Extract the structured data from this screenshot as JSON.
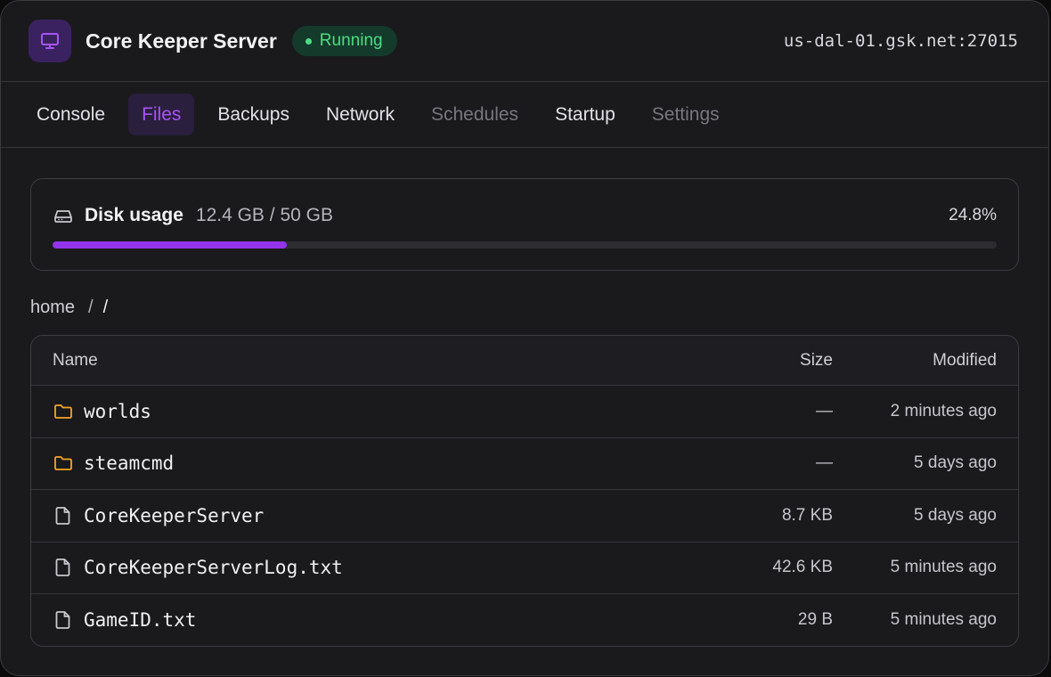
{
  "header": {
    "title": "Core Keeper Server",
    "status": "Running",
    "address": "us-dal-01.gsk.net:27015"
  },
  "tabs": [
    {
      "label": "Console",
      "state": "normal"
    },
    {
      "label": "Files",
      "state": "active"
    },
    {
      "label": "Backups",
      "state": "normal"
    },
    {
      "label": "Network",
      "state": "normal"
    },
    {
      "label": "Schedules",
      "state": "disabled"
    },
    {
      "label": "Startup",
      "state": "normal"
    },
    {
      "label": "Settings",
      "state": "disabled"
    }
  ],
  "disk": {
    "label": "Disk usage",
    "value": "12.4 GB / 50 GB",
    "percent_label": "24.8%",
    "percent": 24.8
  },
  "breadcrumb": {
    "root": "home",
    "separator": "/",
    "current": "/"
  },
  "table": {
    "columns": {
      "name": "Name",
      "size": "Size",
      "modified": "Modified"
    },
    "rows": [
      {
        "type": "folder",
        "name": "worlds",
        "size": "—",
        "modified": "2 minutes ago"
      },
      {
        "type": "folder",
        "name": "steamcmd",
        "size": "—",
        "modified": "5 days ago"
      },
      {
        "type": "file",
        "name": "CoreKeeperServer",
        "size": "8.7 KB",
        "modified": "5 days ago"
      },
      {
        "type": "file",
        "name": "CoreKeeperServerLog.txt",
        "size": "42.6 KB",
        "modified": "5 minutes ago"
      },
      {
        "type": "file",
        "name": "GameID.txt",
        "size": "29 B",
        "modified": "5 minutes ago"
      }
    ]
  },
  "colors": {
    "accent": "#a855f7",
    "status_green": "#4ade80",
    "folder": "#f5a524"
  },
  "icons": {
    "app": "monitor-icon",
    "disk": "hard-drive-icon",
    "folder": "folder-icon",
    "file": "file-icon"
  }
}
